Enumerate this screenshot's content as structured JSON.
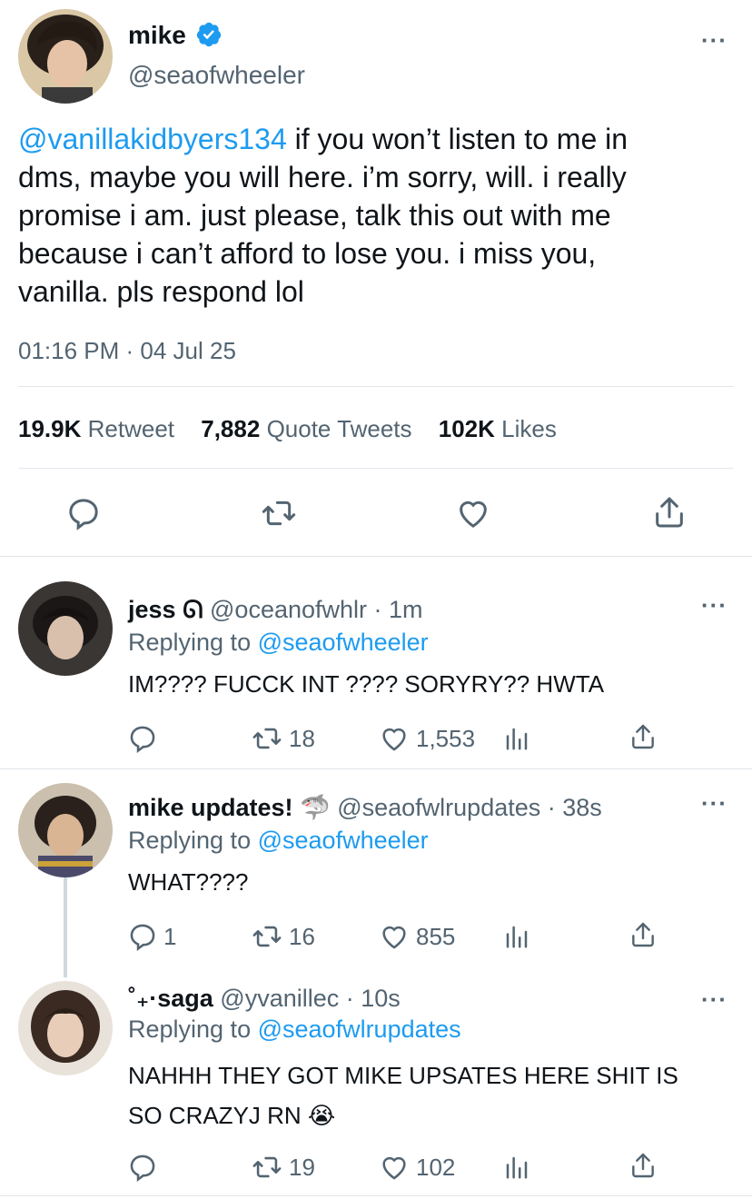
{
  "main_tweet": {
    "display_name": "mike",
    "handle": "@seaofwheeler",
    "mention": "@vanillakidbyers134",
    "text_line1": " if you won’t listen to me in",
    "text_line2": "dms, maybe you will here. i’m sorry, will. i really",
    "text_line3": "promise i am. just please, talk this out with me",
    "text_line4": "because i can’t afford to lose you. i miss you,",
    "text_line5": "vanilla. pls respond lol",
    "timestamp": "01:16 PM · 04 Jul 25",
    "retweets_count": "19.9K",
    "retweets_label": "Retweet",
    "quotes_count": "7,882",
    "quotes_label": "Quote Tweets",
    "likes_count": "102K",
    "likes_label": "Likes"
  },
  "replies": [
    {
      "display_name": "jess",
      "name_emoji": "ᘏ",
      "handle_time": "@oceanofwhlr · 1m",
      "replying_prefix": "Replying to",
      "replying_to": "@seaofwheeler",
      "text": "IM???? FUCCK INT ???? SORYRY?? HWTA",
      "reply_count": "",
      "retweet_count": "18",
      "like_count": "1,553"
    },
    {
      "display_name": "mike updates!",
      "name_emoji": "🦈",
      "handle_time": "@seaofwlrupdates · 38s",
      "replying_prefix": "Replying to",
      "replying_to": "@seaofwheeler",
      "text": "WHAT????",
      "reply_count": "1",
      "retweet_count": "16",
      "like_count": "855"
    },
    {
      "display_name_prefix": "˚₊·",
      "display_name": "saga",
      "handle_time": "@yvanillec · 10s",
      "replying_prefix": "Replying to",
      "replying_to": "@seaofwlrupdates",
      "text_line1": "NAHHH THEY GOT MIKE UPSATES HERE SHIT IS",
      "text_line2": "SO CRAZYJ RN 😭",
      "reply_count": "",
      "retweet_count": "19",
      "like_count": "102"
    }
  ],
  "colors": {
    "link": "#1d9bf0",
    "secondary": "#536471",
    "divider": "#e1e6ea"
  },
  "icons": [
    "verified-badge-icon",
    "more-icon",
    "reply-icon",
    "retweet-icon",
    "like-icon",
    "share-icon",
    "analytics-icon"
  ]
}
